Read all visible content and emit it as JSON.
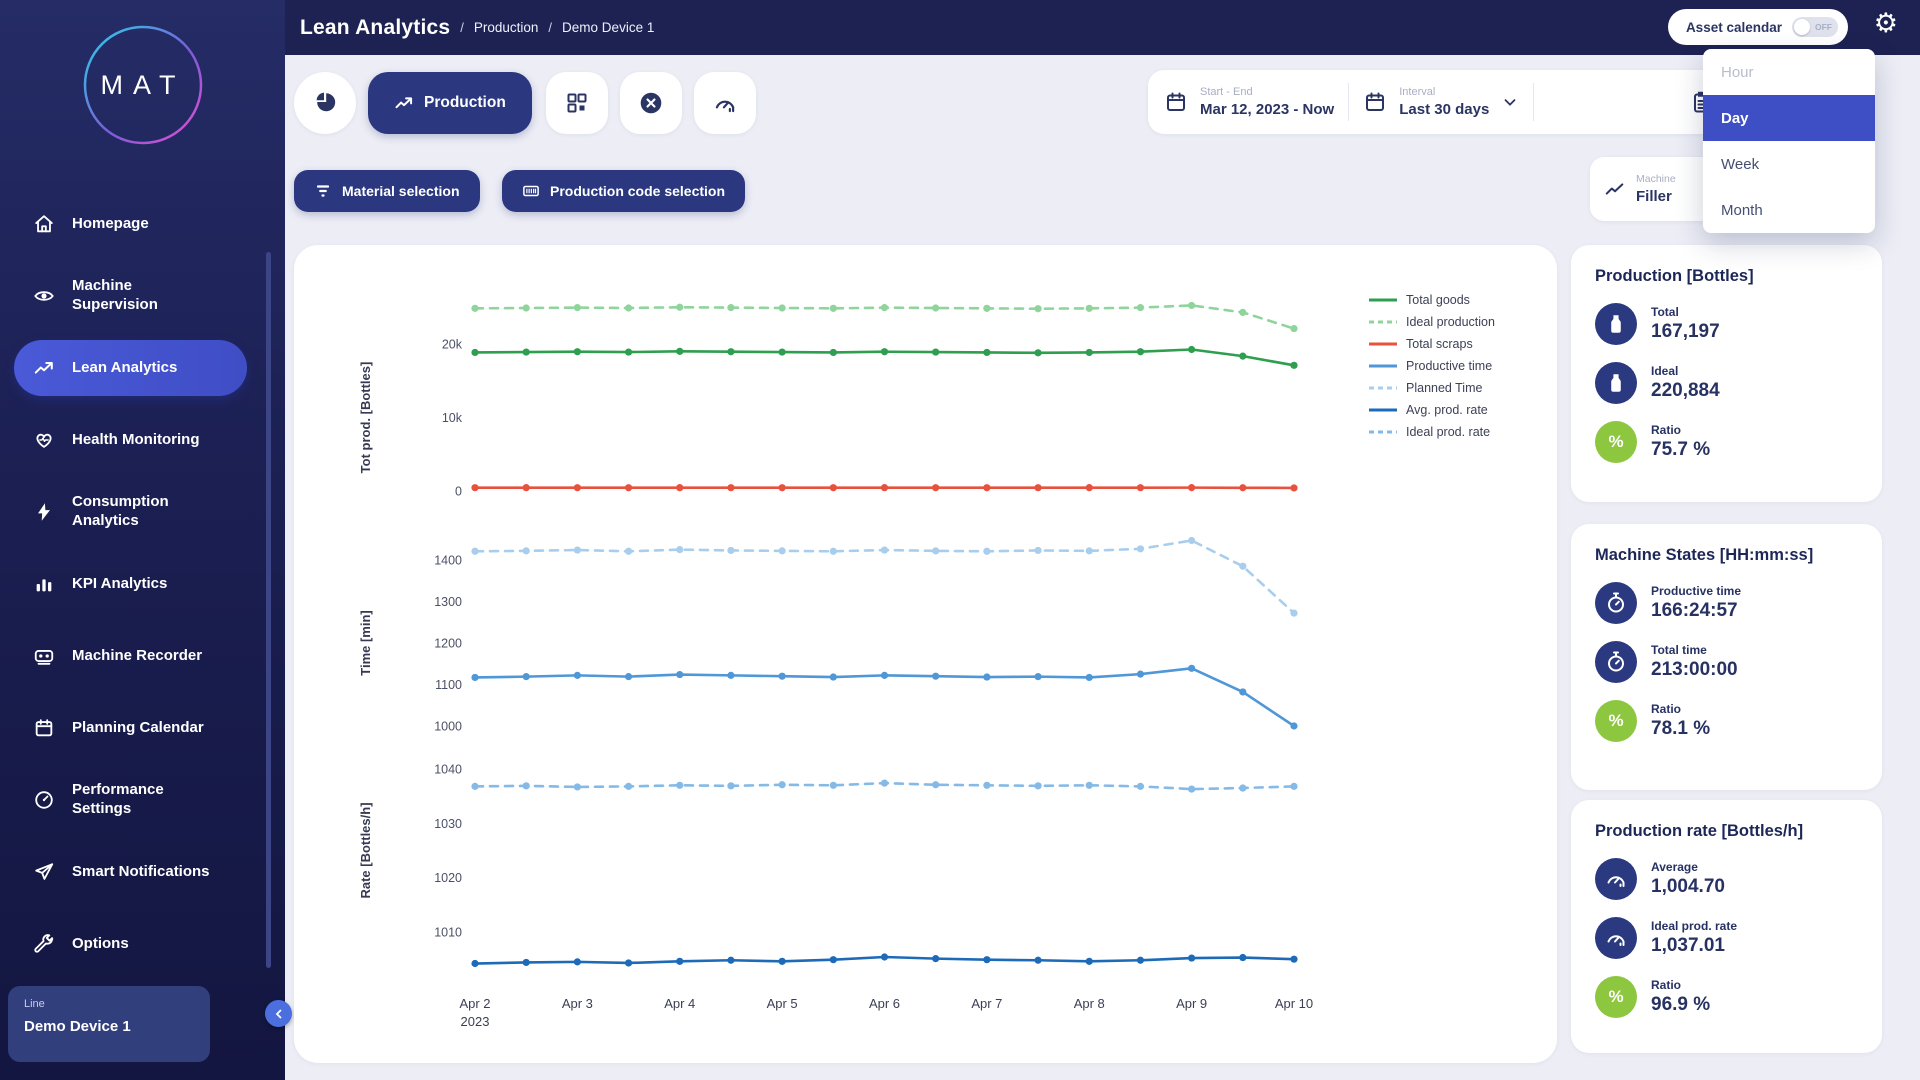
{
  "colors": {
    "navy": "#2b3a80",
    "header_navy": "#1d2252",
    "accent_blue": "#3e4fc6",
    "lime": "#8dc63f",
    "green": "#2e9e4f",
    "green_light": "#8fd49b",
    "red": "#e8513d",
    "blue": "#4f97d7",
    "blue_light": "#a9cdec",
    "blue_dark": "#1d6bb8",
    "blue_pale": "#85b9e6"
  },
  "header": {
    "breadcrumb": {
      "title": "Lean Analytics",
      "separator": "/",
      "items": [
        "Production",
        "Demo Device 1"
      ]
    },
    "asset_calendar": {
      "label": "Asset calendar",
      "state": "OFF"
    }
  },
  "sidebar": {
    "logo_text": "MAT",
    "items": [
      {
        "label": "Homepage"
      },
      {
        "label": "Machine Supervision"
      },
      {
        "label": "Lean Analytics",
        "active": true
      },
      {
        "label": "Health Monitoring"
      },
      {
        "label": "Consumption Analytics"
      },
      {
        "label": "KPI Analytics"
      },
      {
        "label": "Machine Recorder"
      },
      {
        "label": "Planning Calendar"
      },
      {
        "label": "Performance Settings"
      },
      {
        "label": "Smart Notifications"
      },
      {
        "label": "Options"
      }
    ],
    "device": {
      "label": "Line",
      "name": "Demo Device 1"
    }
  },
  "toolbar": {
    "production_label": "Production",
    "material_label": "Material selection",
    "production_code_label": "Production code selection",
    "date_range": {
      "label": "Start - End",
      "value": "Mar 12, 2023 - Now"
    },
    "interval": {
      "label": "Interval",
      "value": "Last 30 days"
    }
  },
  "machine_selector": {
    "label": "Machine",
    "value": "Filler"
  },
  "interval_dropdown": {
    "options": [
      {
        "label": "Hour",
        "state": "muted"
      },
      {
        "label": "Day",
        "state": "selected"
      },
      {
        "label": "Week",
        "state": "normal"
      },
      {
        "label": "Month",
        "state": "normal"
      }
    ]
  },
  "legend": [
    {
      "name": "Total goods",
      "color": "#2e9e4f",
      "dashed": false
    },
    {
      "name": "Ideal production",
      "color": "#8fd49b",
      "dashed": true
    },
    {
      "name": "Total scraps",
      "color": "#e8513d",
      "dashed": false
    },
    {
      "name": "Productive time",
      "color": "#4f97d7",
      "dashed": false
    },
    {
      "name": "Planned Time",
      "color": "#a9cdec",
      "dashed": true
    },
    {
      "name": "Avg. prod. rate",
      "color": "#1d6bb8",
      "dashed": false
    },
    {
      "name": "Ideal prod. rate",
      "color": "#85b9e6",
      "dashed": true
    }
  ],
  "chart_data": [
    {
      "type": "line",
      "ylabel": "Tot prod. [Bottles]",
      "ylim": [
        0,
        27000
      ],
      "yticks": [
        {
          "v": 0,
          "label": "0"
        },
        {
          "v": 10000,
          "label": "10k"
        },
        {
          "v": 20000,
          "label": "20k"
        }
      ],
      "x_labels": [
        [
          "Apr 2",
          "2023"
        ],
        [
          "Apr 3"
        ],
        [
          "Apr 4"
        ],
        [
          "Apr 5"
        ],
        [
          "Apr 6"
        ],
        [
          "Apr 7"
        ],
        [
          "Apr 8"
        ],
        [
          "Apr 9"
        ],
        [
          "Apr 10"
        ]
      ],
      "series": [
        {
          "name": "Ideal production",
          "color": "#8fd49b",
          "dashed": true,
          "values": [
            24850,
            24900,
            24950,
            24900,
            25000,
            24950,
            24900,
            24850,
            24950,
            24900,
            24850,
            24800,
            24850,
            24950,
            25250,
            24300,
            22100
          ]
        },
        {
          "name": "Total goods",
          "color": "#2e9e4f",
          "dashed": false,
          "values": [
            18850,
            18900,
            18950,
            18900,
            19000,
            18950,
            18900,
            18850,
            18950,
            18900,
            18850,
            18800,
            18850,
            18950,
            19250,
            18350,
            17100
          ]
        },
        {
          "name": "Total scraps",
          "color": "#e8513d",
          "dashed": false,
          "values": [
            450,
            455,
            450,
            445,
            455,
            450,
            445,
            450,
            455,
            450,
            445,
            450,
            455,
            450,
            460,
            440,
            420
          ]
        }
      ]
    },
    {
      "type": "line",
      "ylabel": "Time [min]",
      "ylim": [
        990,
        1460
      ],
      "yticks": [
        {
          "v": 1000,
          "label": "1000"
        },
        {
          "v": 1100,
          "label": "1100"
        },
        {
          "v": 1200,
          "label": "1200"
        },
        {
          "v": 1300,
          "label": "1300"
        },
        {
          "v": 1400,
          "label": "1400"
        }
      ],
      "x_labels": [
        [
          "Apr 2",
          "2023"
        ],
        [
          "Apr 3"
        ],
        [
          "Apr 4"
        ],
        [
          "Apr 5"
        ],
        [
          "Apr 6"
        ],
        [
          "Apr 7"
        ],
        [
          "Apr 8"
        ],
        [
          "Apr 9"
        ],
        [
          "Apr 10"
        ]
      ],
      "series": [
        {
          "name": "Planned Time",
          "color": "#a9cdec",
          "dashed": true,
          "values": [
            1421,
            1422,
            1424,
            1421,
            1425,
            1423,
            1422,
            1421,
            1424,
            1422,
            1421,
            1423,
            1422,
            1427,
            1447,
            1385,
            1272
          ]
        },
        {
          "name": "Productive time",
          "color": "#4f97d7",
          "dashed": false,
          "values": [
            1117,
            1119,
            1122,
            1119,
            1124,
            1122,
            1120,
            1118,
            1122,
            1120,
            1118,
            1119,
            1117,
            1125,
            1139,
            1082,
            1000
          ]
        }
      ]
    },
    {
      "type": "line",
      "ylabel": "Rate [Bottles/h]",
      "ylim": [
        1000,
        1043
      ],
      "yticks": [
        {
          "v": 1010,
          "label": "1010"
        },
        {
          "v": 1020,
          "label": "1020"
        },
        {
          "v": 1030,
          "label": "1030"
        },
        {
          "v": 1040,
          "label": "1040"
        }
      ],
      "x_labels": [
        [
          "Apr 2",
          "2023"
        ],
        [
          "Apr 3"
        ],
        [
          "Apr 4"
        ],
        [
          "Apr 5"
        ],
        [
          "Apr 6"
        ],
        [
          "Apr 7"
        ],
        [
          "Apr 8"
        ],
        [
          "Apr 9"
        ],
        [
          "Apr 10"
        ]
      ],
      "series": [
        {
          "name": "Ideal prod. rate",
          "color": "#85b9e6",
          "dashed": true,
          "values": [
            1036.8,
            1036.9,
            1036.7,
            1036.8,
            1037.0,
            1036.9,
            1037.1,
            1037.0,
            1037.4,
            1037.1,
            1037.0,
            1036.9,
            1037.0,
            1036.8,
            1036.3,
            1036.5,
            1036.8
          ]
        },
        {
          "name": "Avg. prod. rate",
          "color": "#1d6bb8",
          "dashed": false,
          "values": [
            1004.2,
            1004.4,
            1004.5,
            1004.3,
            1004.6,
            1004.8,
            1004.6,
            1004.9,
            1005.4,
            1005.1,
            1004.9,
            1004.8,
            1004.6,
            1004.8,
            1005.2,
            1005.3,
            1005.0
          ]
        }
      ]
    }
  ],
  "summary_cards": [
    {
      "title": "Production [Bottles]",
      "rows": [
        {
          "icon": "bottle",
          "label": "Total",
          "value": "167,197"
        },
        {
          "icon": "bottle",
          "label": "Ideal",
          "value": "220,884"
        },
        {
          "icon": "percent",
          "label": "Ratio",
          "value": "75.7 %"
        }
      ]
    },
    {
      "title": "Machine States [HH:mm:ss]",
      "rows": [
        {
          "icon": "stopwatch",
          "label": "Productive time",
          "value": "166:24:57"
        },
        {
          "icon": "stopwatch",
          "label": "Total time",
          "value": "213:00:00"
        },
        {
          "icon": "percent",
          "label": "Ratio",
          "value": "78.1 %"
        }
      ]
    },
    {
      "title": "Production rate [Bottles/h]",
      "rows": [
        {
          "icon": "gauge",
          "label": "Average",
          "value": "1,004.70"
        },
        {
          "icon": "gauge",
          "label": "Ideal prod. rate",
          "value": "1,037.01"
        },
        {
          "icon": "percent",
          "label": "Ratio",
          "value": "96.9 %"
        }
      ]
    }
  ]
}
